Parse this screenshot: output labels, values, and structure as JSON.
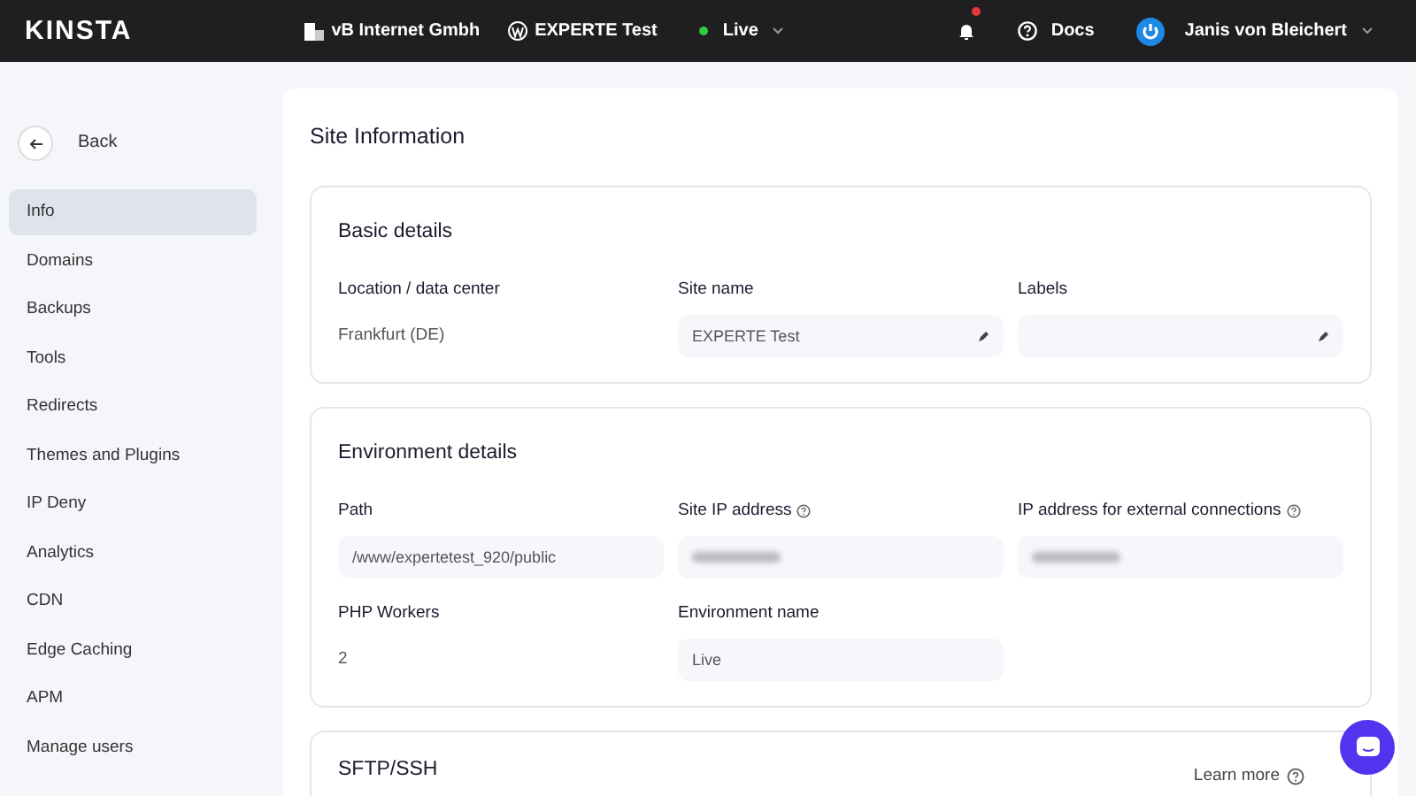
{
  "topbar": {
    "logo": "KINSTA",
    "company": "vB Internet Gmbh",
    "site": "EXPERTE Test",
    "environment": {
      "label": "Live",
      "live": true
    },
    "notifications": {
      "unread": true
    },
    "docs": "Docs",
    "user": "Janis von Bleichert"
  },
  "sidebar": {
    "back": "Back",
    "items": [
      {
        "label": "Info",
        "selected": true
      },
      {
        "label": "Domains",
        "selected": false
      },
      {
        "label": "Backups",
        "selected": false
      },
      {
        "label": "Tools",
        "selected": false
      },
      {
        "label": "Redirects",
        "selected": false
      },
      {
        "label": "Themes and Plugins",
        "selected": false
      },
      {
        "label": "IP Deny",
        "selected": false
      },
      {
        "label": "Analytics",
        "selected": false
      },
      {
        "label": "CDN",
        "selected": false
      },
      {
        "label": "Edge Caching",
        "selected": false
      },
      {
        "label": "APM",
        "selected": false
      },
      {
        "label": "Manage users",
        "selected": false
      }
    ]
  },
  "page": {
    "title": "Site Information",
    "sections": [
      {
        "title": "Basic details",
        "fields": [
          {
            "label": "Location / data center",
            "kind": "text",
            "value": "Frankfurt (DE)",
            "info": false
          },
          {
            "label": "Site name",
            "kind": "editable",
            "value": "EXPERTE Test",
            "info": false
          },
          {
            "label": "Labels",
            "kind": "editable",
            "info": false
          }
        ]
      },
      {
        "title": "Environment details",
        "fields": [
          {
            "label": "Path",
            "kind": "box",
            "value": "/www/expertetest_920/public",
            "info": false
          },
          {
            "label": "Site IP address",
            "kind": "redacted",
            "info": true
          },
          {
            "label": "IP address for external connections",
            "kind": "redacted",
            "info": true
          },
          {
            "label": "PHP Workers",
            "kind": "text",
            "value": "2",
            "info": false
          },
          {
            "label": "Environment name",
            "kind": "box",
            "value": "Live",
            "info": false
          }
        ]
      },
      {
        "title": "SFTP/SSH",
        "link": "Learn more"
      }
    ]
  }
}
